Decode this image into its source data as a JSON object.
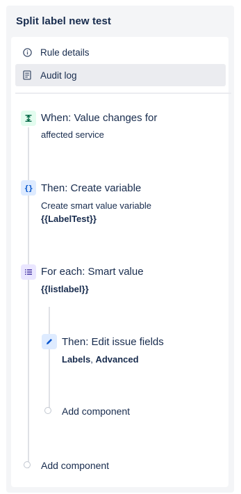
{
  "panel": {
    "title": "Split label new test"
  },
  "menu": [
    {
      "label": "Rule details",
      "icon": "info-icon",
      "selected": false
    },
    {
      "label": "Audit log",
      "icon": "document-icon",
      "selected": true
    }
  ],
  "components": {
    "trigger": {
      "title": "When: Value changes for",
      "subtitle": "affected service",
      "icon": "trigger-icon",
      "icon_color": "#e3fcef",
      "icon_glyph_color": "#006644"
    },
    "create_variable": {
      "title": "Then: Create variable",
      "subtitle": "Create smart value variable",
      "value": "{{LabelTest}}",
      "icon": "curly-braces-icon",
      "icon_color": "#deebff",
      "icon_glyph_color": "#0052cc"
    },
    "for_each": {
      "title": "For each: Smart value",
      "value": "{{listlabel}}",
      "icon": "list-icon",
      "icon_color": "#eae6ff",
      "icon_glyph_color": "#5243aa"
    },
    "edit_fields": {
      "title": "Then: Edit issue fields",
      "field_1": "Labels",
      "separator": ",",
      "field_2": "Advanced",
      "icon": "pencil-icon",
      "icon_color": "#deebff",
      "icon_glyph_color": "#0052cc"
    },
    "add_nested": {
      "label": "Add component"
    },
    "add_root": {
      "label": "Add component"
    }
  }
}
